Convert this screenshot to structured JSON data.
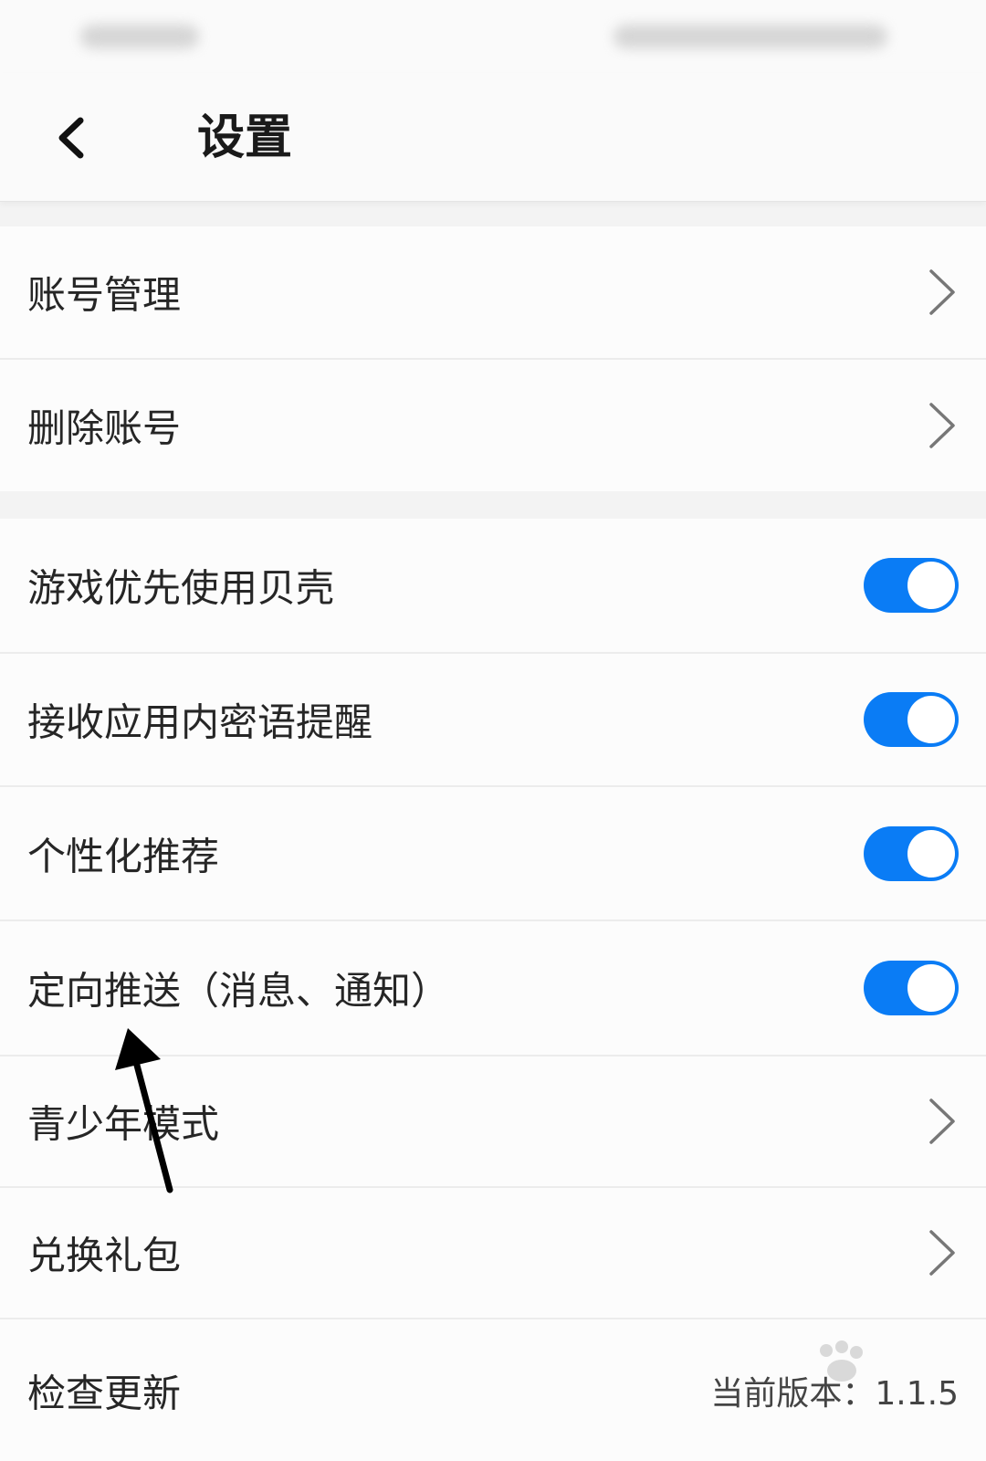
{
  "header": {
    "title": "设置"
  },
  "groups": [
    {
      "items": [
        {
          "label": "账号管理",
          "control": "chevron"
        },
        {
          "label": "删除账号",
          "control": "chevron"
        }
      ]
    },
    {
      "items": [
        {
          "label": "游戏优先使用贝壳",
          "control": "toggle",
          "on": true
        },
        {
          "label": "接收应用内密语提醒",
          "control": "toggle",
          "on": true
        },
        {
          "label": "个性化推荐",
          "control": "toggle",
          "on": true
        },
        {
          "label": "定向推送（消息、通知）",
          "control": "toggle",
          "on": true
        },
        {
          "label": "青少年模式",
          "control": "chevron"
        },
        {
          "label": "兑换礼包",
          "control": "chevron"
        },
        {
          "label": "检查更新",
          "control": "version",
          "version_text": "当前版本：1.1.5"
        }
      ]
    }
  ],
  "colors": {
    "toggle_on": "#0a7cf5",
    "row_background": "#fcfcfc",
    "page_background": "#f3f3f3"
  },
  "icons": {
    "back": "chevron-left-icon",
    "row_arrow": "chevron-right-icon",
    "annotation": "arrow-up-icon"
  }
}
